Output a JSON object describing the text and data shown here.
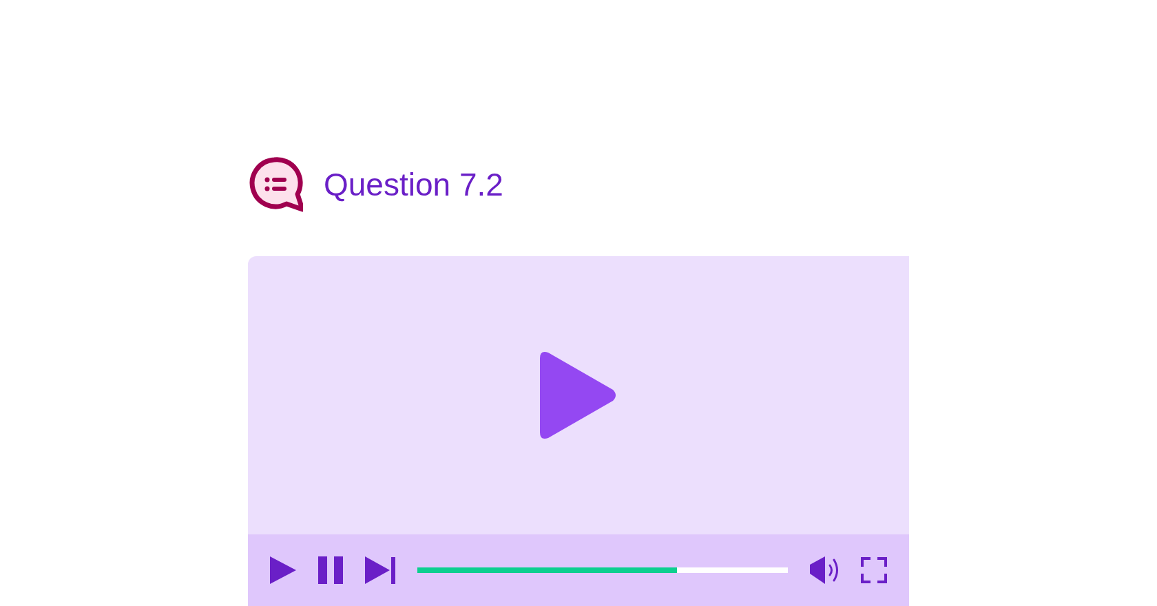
{
  "title": "Question 7.2",
  "player": {
    "progress": {
      "level": 0.7
    }
  }
}
